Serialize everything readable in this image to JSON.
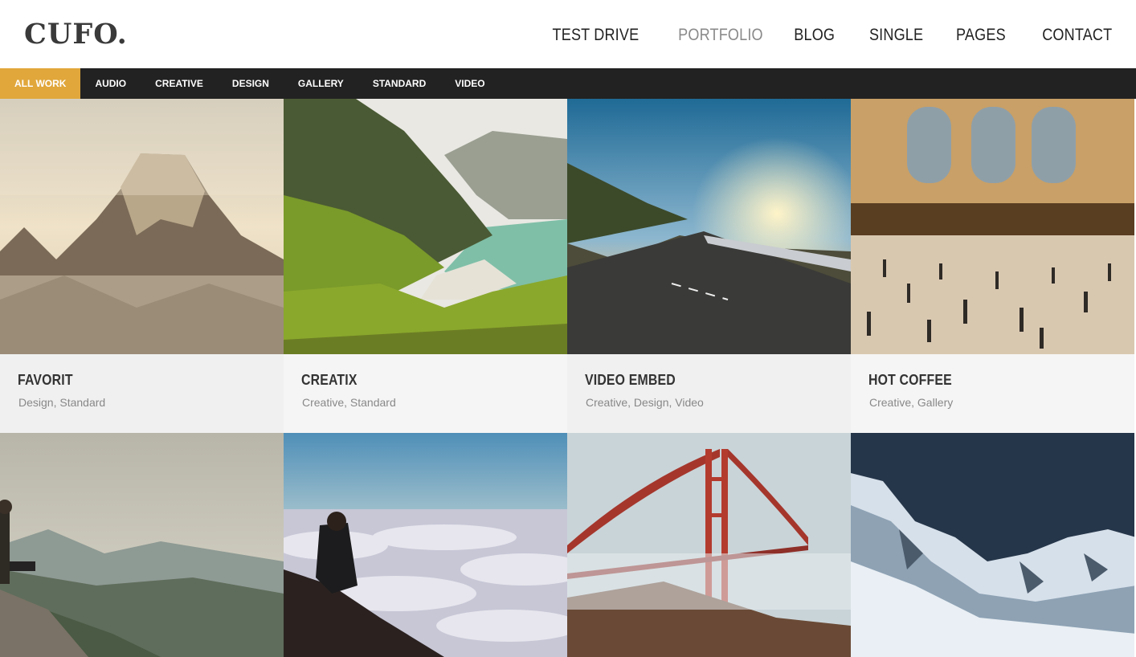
{
  "brand": {
    "logo": "CUFO."
  },
  "nav": [
    {
      "label": "TEST DRIVE"
    },
    {
      "label": "PORTFOLIO",
      "active": true
    },
    {
      "label": "BLOG"
    },
    {
      "label": "SINGLE"
    },
    {
      "label": "PAGES"
    },
    {
      "label": "CONTACT"
    }
  ],
  "filters": [
    {
      "label": "ALL WORK",
      "active": true
    },
    {
      "label": "AUDIO"
    },
    {
      "label": "CREATIVE"
    },
    {
      "label": "DESIGN"
    },
    {
      "label": "GALLERY"
    },
    {
      "label": "STANDARD"
    },
    {
      "label": "VIDEO"
    }
  ],
  "portfolio": {
    "row1": [
      {
        "title": "FAVORIT",
        "categories": "Design, Standard",
        "image": "misty-mountain-photo"
      },
      {
        "title": "CREATIX",
        "categories": "Creative, Standard",
        "image": "green-coast-photo"
      },
      {
        "title": "VIDEO EMBED",
        "categories": "Creative, Design, Video",
        "image": "sunset-road-photo"
      },
      {
        "title": "HOT COFFEE",
        "categories": "Creative, Gallery",
        "image": "grand-hall-photo"
      }
    ],
    "row2": [
      {
        "image": "man-on-ledge-photo"
      },
      {
        "image": "man-above-clouds-photo"
      },
      {
        "image": "red-bridge-fog-photo"
      },
      {
        "image": "snowy-peaks-photo"
      }
    ]
  },
  "colors": {
    "accent": "#e1a73b",
    "filterbar": "#222222",
    "caption_bg": "#f0f0f0"
  }
}
